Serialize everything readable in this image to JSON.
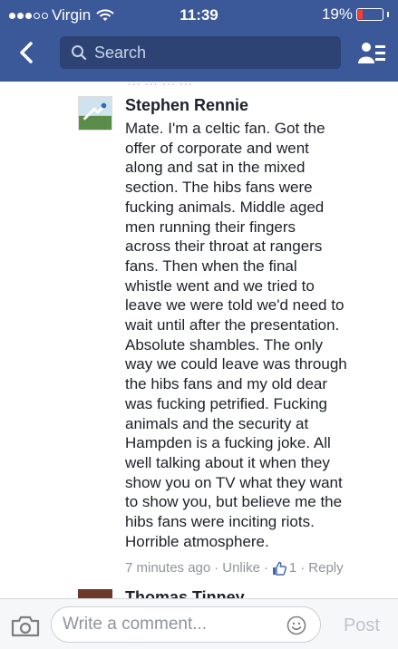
{
  "status_bar": {
    "carrier": "Virgin",
    "time": "11:39",
    "battery": "19%"
  },
  "nav": {
    "search_placeholder": "Search"
  },
  "comment": {
    "author": "Stephen Rennie",
    "lines": [
      "Mate. I'm a celtic fan. Got the",
      "offer of corporate and went",
      "along and sat in the mixed",
      "section. The hibs fans were",
      "fucking animals. Middle aged",
      "men running their fingers",
      "across their throat at rangers",
      "fans. Then when the final",
      "whistle went and we tried to",
      "leave we were told we'd need to",
      "wait until after the presentation.",
      "Absolute shambles. The only",
      "way we could leave was through",
      "the hibs fans and my old dear",
      "was fucking petrified. Fucking",
      "animals and the security at",
      "Hampden is a fucking joke. All",
      "well talking about it when they",
      "show you on TV what they want",
      "to show you, but believe me the",
      "hibs fans were inciting riots.",
      "Horrible atmosphere."
    ],
    "time": "7 minutes ago",
    "unlike": "Unlike",
    "like_count": "1",
    "reply": "Reply"
  },
  "next_comment": {
    "author": "Thomas Tinney"
  },
  "composer": {
    "placeholder": "Write a comment...",
    "post_label": "Post"
  },
  "colors": {
    "brand": "#3b5998",
    "like": "#4267b2",
    "battery_low": "#ff3b30"
  }
}
